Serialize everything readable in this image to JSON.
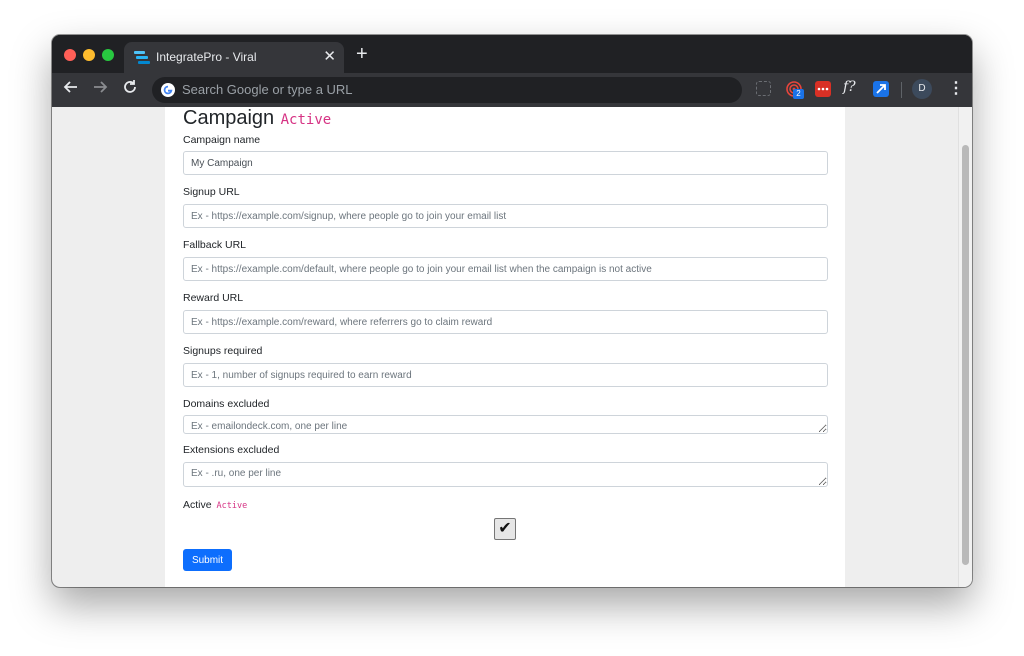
{
  "browser": {
    "tab_title": "IntegratePro - Viral",
    "tab_close_glyph": "✕",
    "new_tab_glyph": "+",
    "omnibox_placeholder": "Search Google or type a URL",
    "extension_badge_count": "2",
    "extension_fx_label": "f?",
    "profile_initial": "D",
    "icons": [
      "back-arrow-icon",
      "forward-arrow-icon",
      "reload-icon",
      "google-icon",
      "menu-dots-icon"
    ]
  },
  "page": {
    "title": "Campaign",
    "status": "Active",
    "fields": {
      "campaign_name": {
        "label": "Campaign name",
        "value": "My Campaign",
        "placeholder": ""
      },
      "signup_url": {
        "label": "Signup URL",
        "placeholder": "Ex - https://example.com/signup, where people go to join your email list"
      },
      "fallback_url": {
        "label": "Fallback URL",
        "placeholder": "Ex - https://example.com/default, where people go to join your email list when the campaign is not active"
      },
      "reward_url": {
        "label": "Reward URL",
        "placeholder": "Ex - https://example.com/reward, where referrers go to claim reward"
      },
      "signups_required": {
        "label": "Signups required",
        "placeholder": "Ex - 1, number of signups required to earn reward"
      },
      "domains_excluded": {
        "label": "Domains excluded",
        "placeholder": "Ex - emailondeck.com, one per line"
      },
      "extensions_excluded": {
        "label": "Extensions excluded",
        "placeholder": "Ex - .ru, one per line"
      }
    },
    "active": {
      "label": "Active",
      "badge": "Active",
      "checked": true,
      "check_glyph": "✔"
    },
    "submit_label": "Submit"
  },
  "colors": {
    "accent": "#0d6efd",
    "status_pink": "#d63384",
    "browser_chrome": "#35363a"
  }
}
